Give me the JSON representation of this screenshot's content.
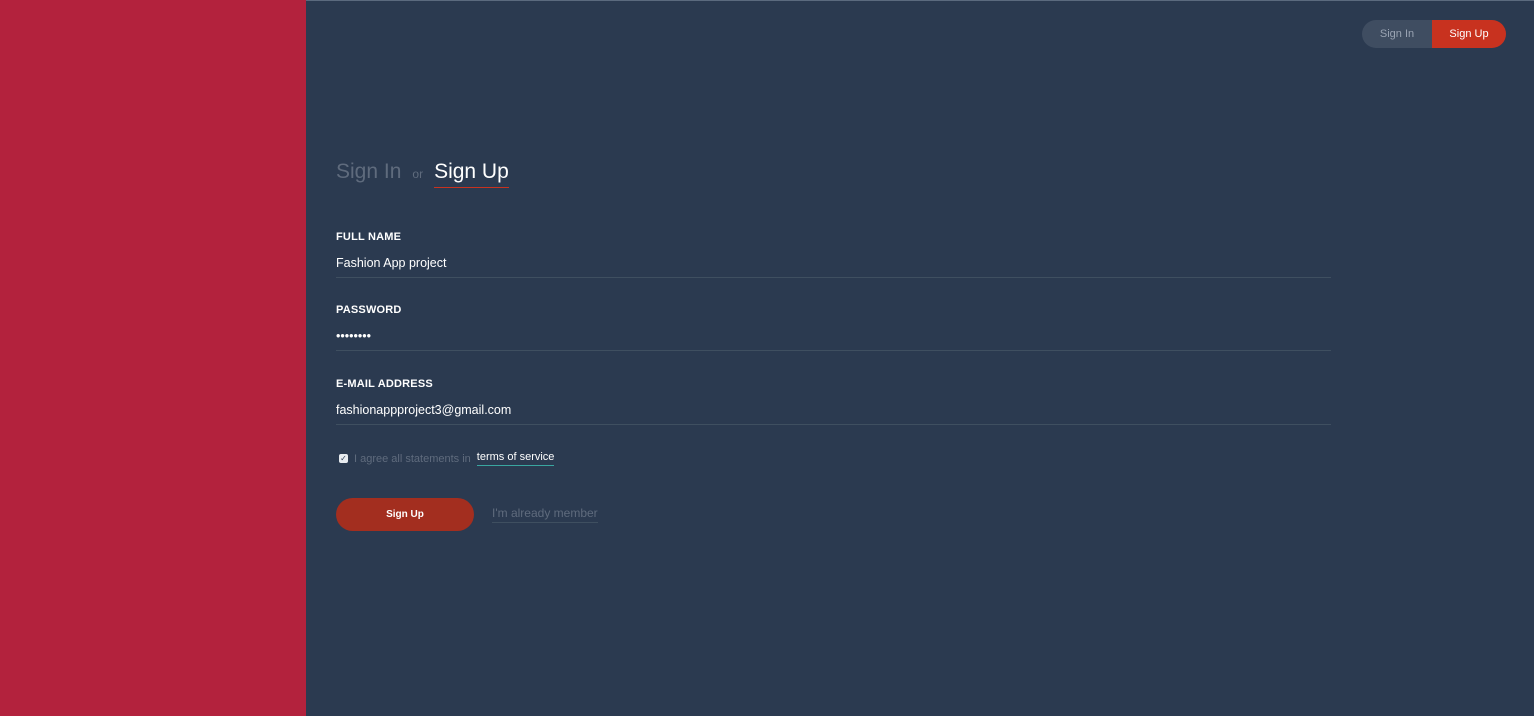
{
  "header": {
    "switch_signin": "Sign In",
    "switch_signup": "Sign Up"
  },
  "form": {
    "title_signin": "Sign In",
    "title_or": "or",
    "title_signup": "Sign Up",
    "fields": [
      {
        "label": "FULL NAME",
        "value": "Fashion App project"
      },
      {
        "label": "PASSWORD",
        "value": "••••••••"
      },
      {
        "label": "E-MAIL ADDRESS",
        "value": "fashionappproject3@gmail.com"
      }
    ],
    "agree_text": "I agree all statements in",
    "terms_link": "terms of service",
    "agree_checked": true,
    "submit_label": "Sign Up",
    "member_link": "I'm already member"
  },
  "colors": {
    "left_panel": "#b3223d",
    "background": "#2b3a50",
    "accent": "#c8321f",
    "submit": "#a32e1f"
  }
}
